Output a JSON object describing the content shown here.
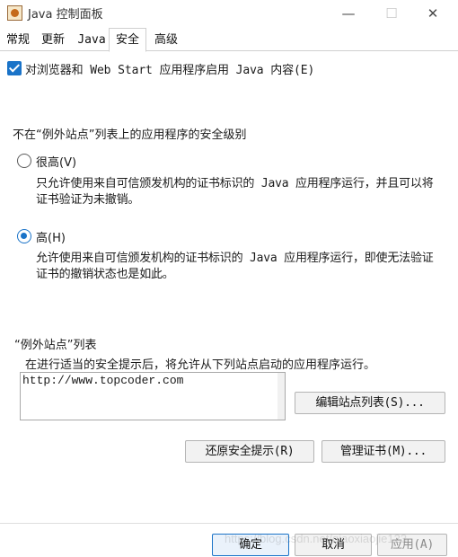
{
  "window": {
    "title": "Java 控制面板",
    "minimize_symbol": "—",
    "maximize_symbol": "☐",
    "close_symbol": "✕"
  },
  "tabs": [
    {
      "label": "常规"
    },
    {
      "label": "更新"
    },
    {
      "label": "Java"
    },
    {
      "label": "安全",
      "active": true
    },
    {
      "label": "高级"
    }
  ],
  "security": {
    "enable_java_label": "对浏览器和 Web Start 应用程序启用 Java 内容(E)",
    "enable_java_checked": true,
    "level_section_title": "不在“例外站点”列表上的应用程序的安全级别",
    "levels": [
      {
        "label": "很高(V)",
        "selected": false,
        "description": "只允许使用来自可信颁发机构的证书标识的 Java 应用程序运行，并且可以将证书验证为未撤销。"
      },
      {
        "label": "高(H)",
        "selected": true,
        "description": "允许使用来自可信颁发机构的证书标识的 Java 应用程序运行，即使无法验证证书的撤销状态也是如此。"
      }
    ],
    "exceptions_title": "“例外站点”列表",
    "exceptions_hint": "在进行适当的安全提示后，将允许从下列站点启动的应用程序运行。",
    "exception_sites": [
      "http://www.topcoder.com"
    ],
    "edit_sites_label": "编辑站点列表(S)...",
    "restore_prompts_label": "还原安全提示(R)",
    "manage_certs_label": "管理证书(M)..."
  },
  "footer": {
    "ok_label": "确定",
    "cancel_label": "取消",
    "apply_label": "应用(A)",
    "apply_enabled": false
  },
  "watermark": "https://blog.csdn.net/qiaoxiaojie123"
}
